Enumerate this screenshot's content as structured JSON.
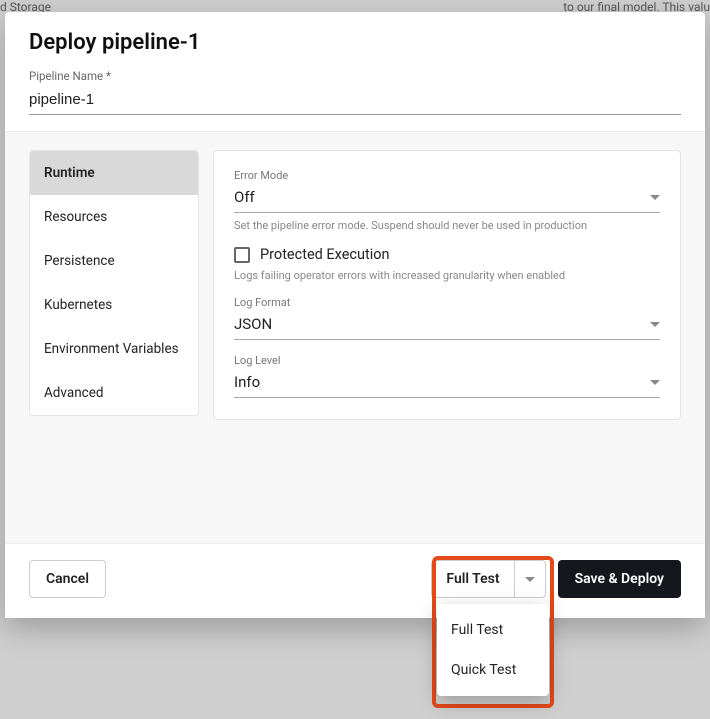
{
  "modal": {
    "title": "Deploy pipeline-1",
    "pipeline_name_label": "Pipeline Name *",
    "pipeline_name_value": "pipeline-1"
  },
  "sidebar": {
    "items": [
      {
        "label": "Runtime",
        "active": true
      },
      {
        "label": "Resources"
      },
      {
        "label": "Persistence"
      },
      {
        "label": "Kubernetes"
      },
      {
        "label": "Environment Variables"
      },
      {
        "label": "Advanced"
      }
    ]
  },
  "runtime": {
    "error_mode": {
      "label": "Error Mode",
      "value": "Off",
      "helper": "Set the pipeline error mode. Suspend should never be used in production"
    },
    "protected_execution": {
      "label": "Protected Execution",
      "helper": "Logs failing operator errors with increased granularity when enabled",
      "checked": false
    },
    "log_format": {
      "label": "Log Format",
      "value": "JSON"
    },
    "log_level": {
      "label": "Log Level",
      "value": "Info"
    }
  },
  "footer": {
    "cancel": "Cancel",
    "save_deploy": "Save & Deploy",
    "split_label": "Full Test",
    "menu": [
      {
        "label": "Full Test"
      },
      {
        "label": "Quick Test"
      }
    ]
  },
  "background": {
    "text1": "d Storage",
    "text2": "to our final model. This valu"
  },
  "colors": {
    "highlight": "#e44a19",
    "dark_button": "#14171c"
  }
}
